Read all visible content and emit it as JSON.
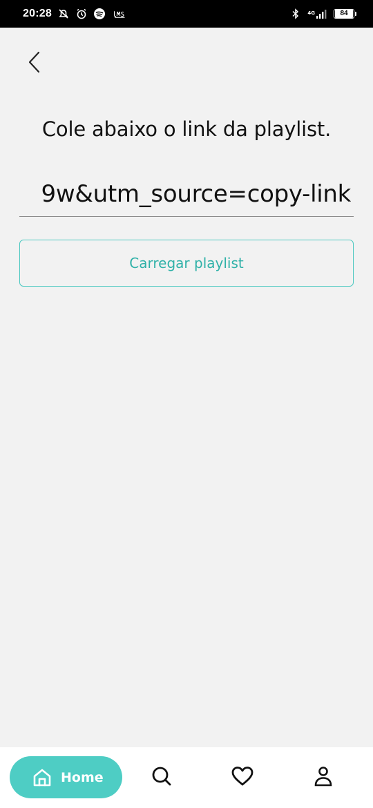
{
  "status_bar": {
    "time": "20:28",
    "network": "4G",
    "battery": "84",
    "icons": [
      "muted-notification-icon",
      "alarm-icon",
      "spotify-icon",
      "app-logo-icon",
      "bluetooth-icon",
      "signal-icon",
      "battery-icon"
    ]
  },
  "header": {
    "back_icon": "chevron-left-icon"
  },
  "main": {
    "title": "Cole abaixo o link da playlist.",
    "link_value": "9w&utm_source=copy-link",
    "load_button_label": "Carregar playlist"
  },
  "bottom_nav": {
    "items": [
      {
        "label": "Home",
        "icon": "home-icon",
        "active": true
      },
      {
        "label": "",
        "icon": "search-icon",
        "active": false
      },
      {
        "label": "",
        "icon": "heart-icon",
        "active": false
      },
      {
        "label": "",
        "icon": "user-icon",
        "active": false
      }
    ]
  },
  "colors": {
    "accent": "#4ecdc4",
    "accent_text": "#2fb1a8",
    "background": "#f2f2f2",
    "status_bar": "#000000"
  }
}
